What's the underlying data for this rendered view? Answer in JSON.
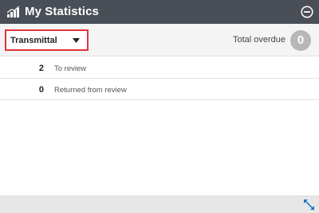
{
  "header": {
    "title": "My Statistics",
    "icon": "bar-chart-icon",
    "collapse_icon": "minus-circle-icon"
  },
  "toolbar": {
    "dropdown_selected": "Transmittal",
    "total_overdue_label": "Total overdue",
    "total_overdue_count": "0"
  },
  "stats": [
    {
      "count": "2",
      "label": "To review"
    },
    {
      "count": "0",
      "label": "Returned from review"
    }
  ],
  "footer": {
    "expand_icon": "expand-arrows-icon"
  },
  "colors": {
    "header_bg": "#4a4f57",
    "dropdown_border": "#e3343b",
    "badge_bg": "#b7b7b7",
    "expand_icon": "#1a73c9"
  }
}
